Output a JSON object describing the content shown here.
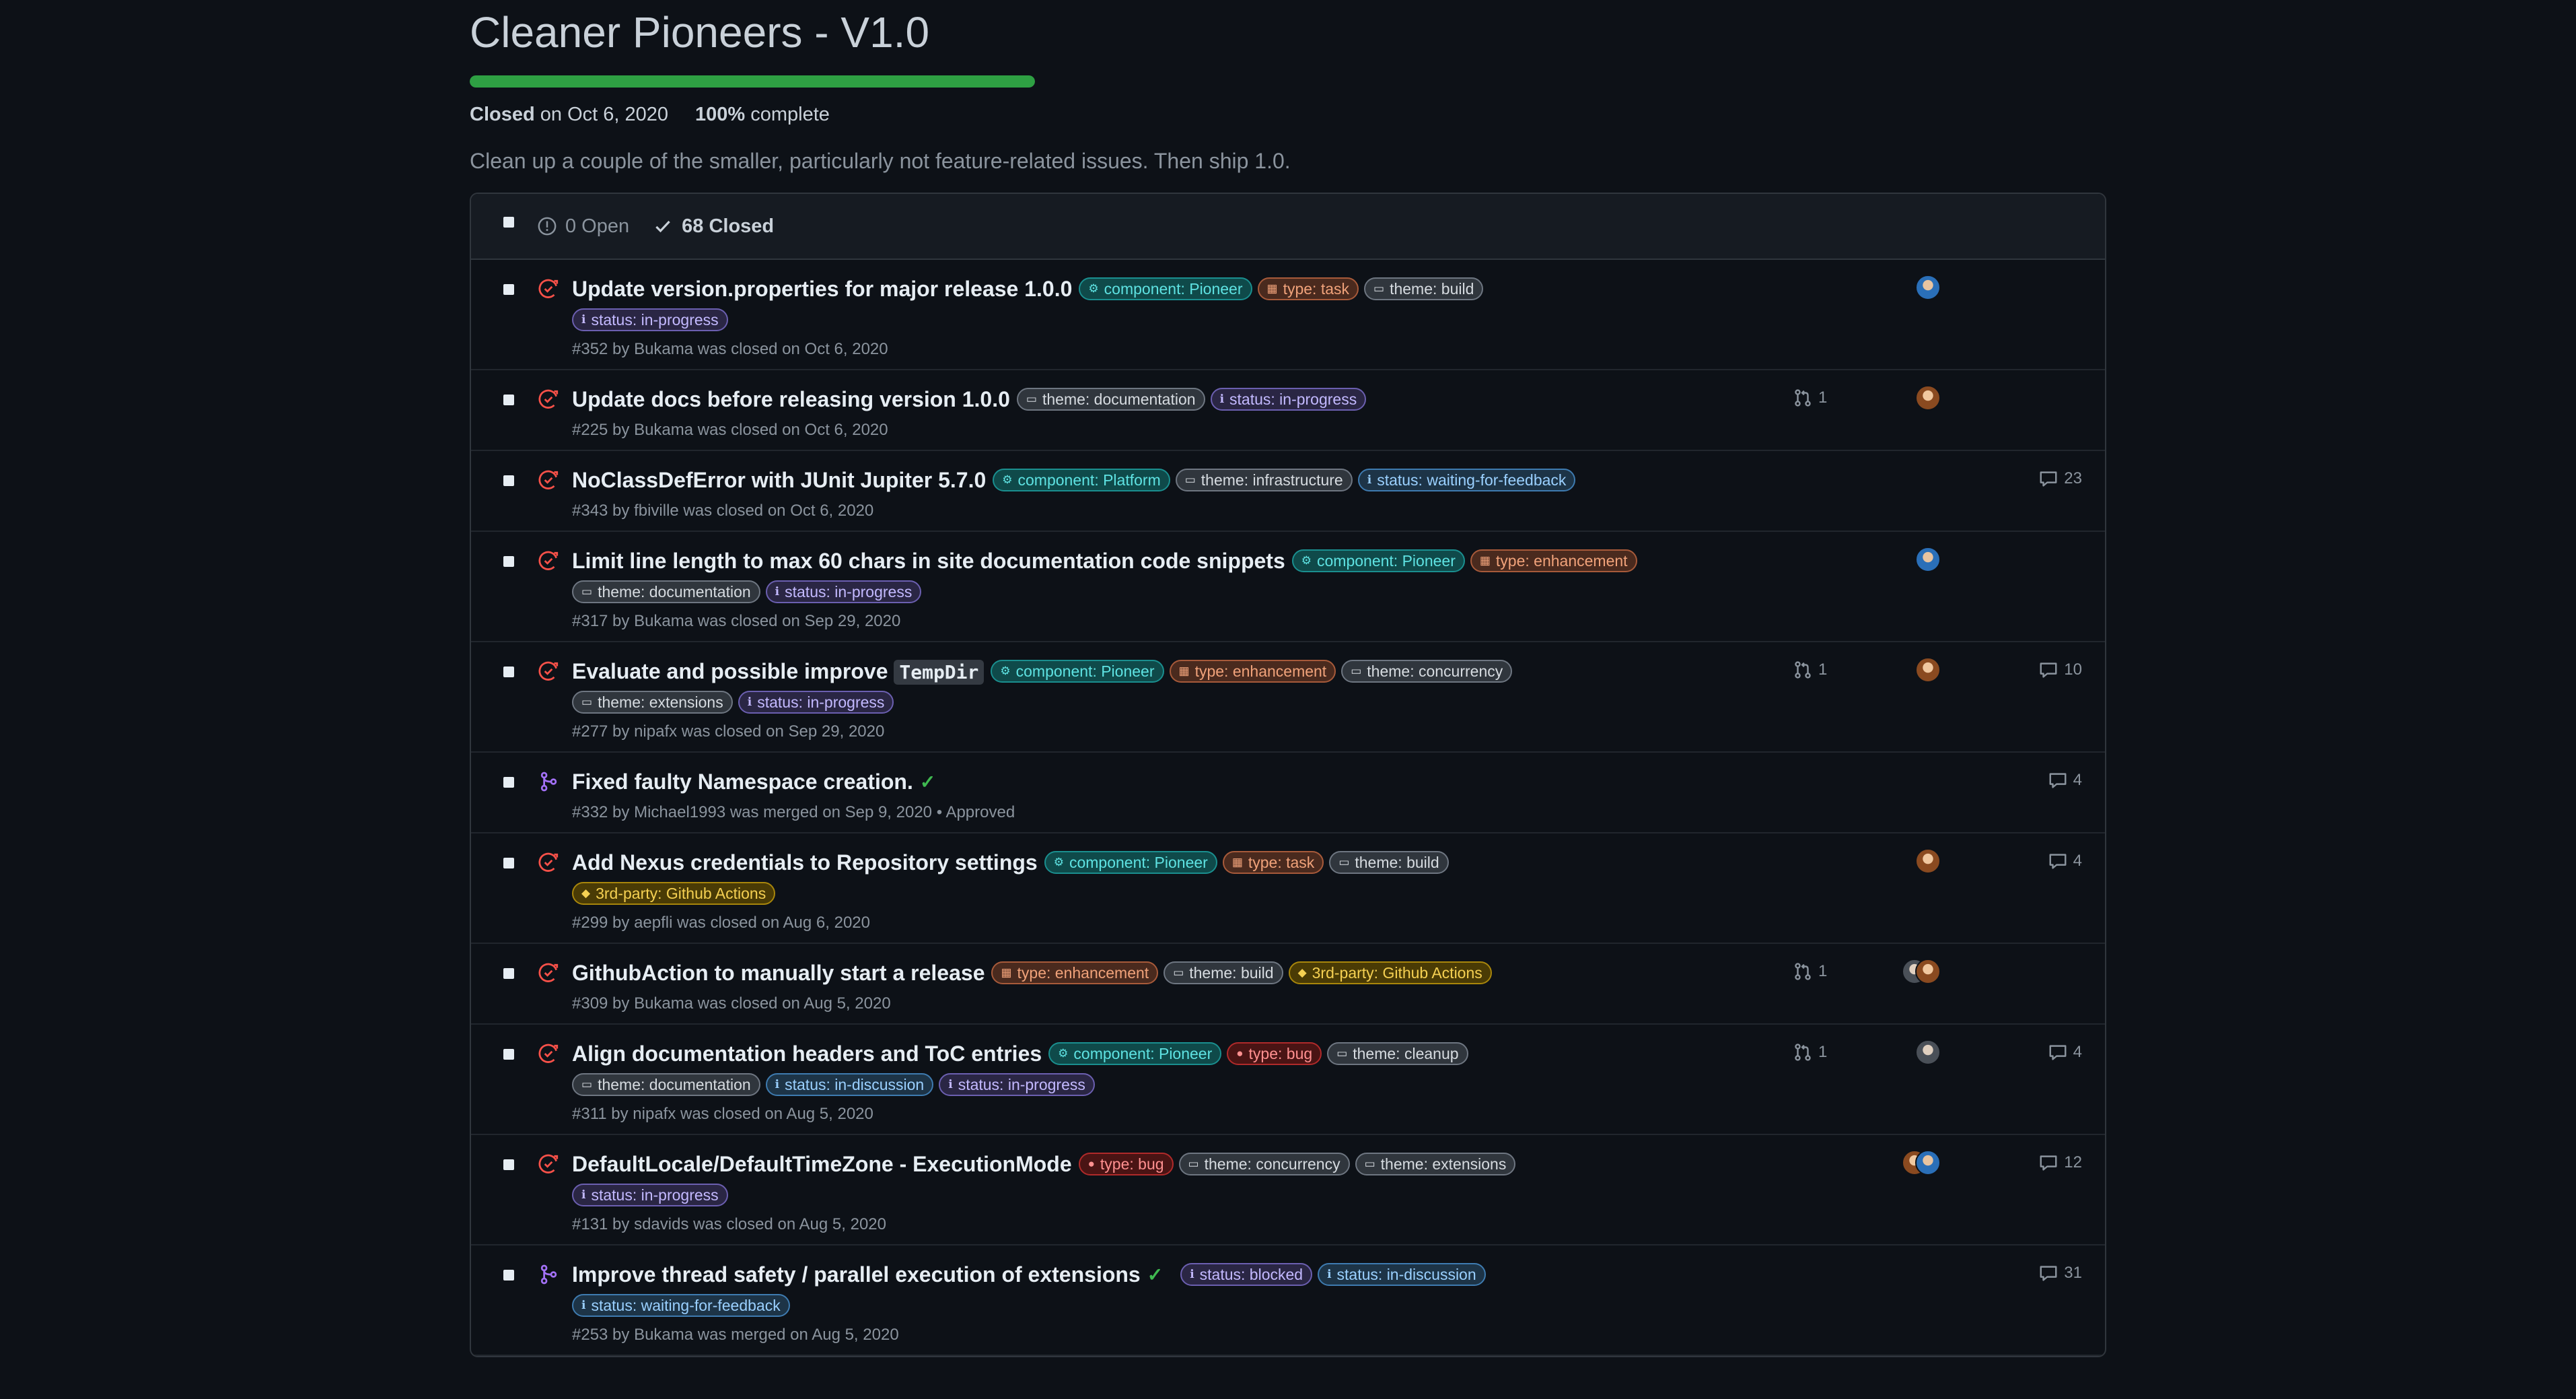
{
  "milestone": {
    "title": "Cleaner Pioneers - V1.0",
    "progress_fraction": 1.0,
    "status_label": "Closed",
    "closed_on": "on Oct 6, 2020",
    "percent_label": "100%",
    "complete_label": "complete",
    "description": "Clean up a couple of the smaller, particularly not feature-related issues. Then ship 1.0."
  },
  "list_header": {
    "open_label": "0 Open",
    "closed_label": "68 Closed"
  },
  "colors": {
    "closed_issue": "#f85149",
    "merged_pr": "#a371f7",
    "progress": "#2ea043",
    "approved_check": "#3fb950"
  },
  "rows": [
    {
      "state": "closed",
      "title": "Update version.properties for major release 1.0.0",
      "labels_line1": [
        {
          "text": "component: Pioneer",
          "kind": "comp",
          "icon": "⚙"
        },
        {
          "text": "type: task",
          "kind": "type",
          "icon": "▦"
        },
        {
          "text": "theme: build",
          "kind": "theme",
          "icon": "▭"
        }
      ],
      "labels_line2": [
        {
          "text": "status: in-progress",
          "kind": "status",
          "icon": "ℹ"
        }
      ],
      "meta": "#352 by Bukama was closed on Oct 6, 2020",
      "prs": "",
      "avatars": [
        "blue"
      ],
      "comments": ""
    },
    {
      "state": "closed",
      "title": "Update docs before releasing version 1.0.0",
      "labels_line1": [
        {
          "text": "theme: documentation",
          "kind": "theme",
          "icon": "▭"
        },
        {
          "text": "status: in-progress",
          "kind": "status",
          "icon": "ℹ"
        }
      ],
      "labels_line2": [],
      "meta": "#225 by Bukama was closed on Oct 6, 2020",
      "prs": "1",
      "avatars": [
        "brown"
      ],
      "comments": ""
    },
    {
      "state": "closed",
      "title": "NoClassDefError with JUnit Jupiter 5.7.0",
      "labels_line1": [
        {
          "text": "component: Platform",
          "kind": "comp",
          "icon": "⚙"
        },
        {
          "text": "theme: infrastructure",
          "kind": "theme",
          "icon": "▭"
        },
        {
          "text": "status: waiting-for-feedback",
          "kind": "statusb",
          "icon": "ℹ"
        }
      ],
      "labels_line2": [],
      "meta": "#343 by fbiville was closed on Oct 6, 2020",
      "prs": "",
      "avatars": [],
      "comments": "23"
    },
    {
      "state": "closed",
      "title": "Limit line length to max 60 chars in site documentation code snippets",
      "labels_line1": [
        {
          "text": "component: Pioneer",
          "kind": "comp",
          "icon": "⚙"
        },
        {
          "text": "type: enhancement",
          "kind": "type",
          "icon": "▦"
        }
      ],
      "labels_line2": [
        {
          "text": "theme: documentation",
          "kind": "theme",
          "icon": "▭"
        },
        {
          "text": "status: in-progress",
          "kind": "status",
          "icon": "ℹ"
        }
      ],
      "meta": "#317 by Bukama was closed on Sep 29, 2020",
      "prs": "",
      "avatars": [
        "blue"
      ],
      "comments": ""
    },
    {
      "state": "closed",
      "title": "Evaluate and possible improve",
      "title_code": "TempDir",
      "labels_line1": [
        {
          "text": "component: Pioneer",
          "kind": "comp",
          "icon": "⚙"
        },
        {
          "text": "type: enhancement",
          "kind": "type",
          "icon": "▦"
        },
        {
          "text": "theme: concurrency",
          "kind": "theme",
          "icon": "▭"
        }
      ],
      "labels_line2": [
        {
          "text": "theme: extensions",
          "kind": "theme",
          "icon": "▭"
        },
        {
          "text": "status: in-progress",
          "kind": "status",
          "icon": "ℹ"
        }
      ],
      "meta": "#277 by nipafx was closed on Sep 29, 2020",
      "prs": "1",
      "avatars": [
        "brown"
      ],
      "comments": "10"
    },
    {
      "state": "merged",
      "title": "Fixed faulty Namespace creation.",
      "approved": true,
      "labels_line1": [],
      "labels_line2": [],
      "meta": "#332 by Michael1993 was merged on Sep 9, 2020 • Approved",
      "prs": "",
      "avatars": [],
      "comments": "4"
    },
    {
      "state": "closed",
      "title": "Add Nexus credentials to Repository settings",
      "labels_line1": [
        {
          "text": "component: Pioneer",
          "kind": "comp",
          "icon": "⚙"
        },
        {
          "text": "type: task",
          "kind": "type",
          "icon": "▦"
        },
        {
          "text": "theme: build",
          "kind": "theme",
          "icon": "▭"
        }
      ],
      "labels_line2": [
        {
          "text": "3rd-party: Github Actions",
          "kind": "3p",
          "icon": "◆"
        }
      ],
      "meta": "#299 by aepfli was closed on Aug 6, 2020",
      "prs": "",
      "avatars": [
        "brown"
      ],
      "comments": "4"
    },
    {
      "state": "closed",
      "title": "GithubAction to manually start a release",
      "labels_line1": [
        {
          "text": "type: enhancement",
          "kind": "type",
          "icon": "▦"
        },
        {
          "text": "theme: build",
          "kind": "theme",
          "icon": "▭"
        },
        {
          "text": "3rd-party: Github Actions",
          "kind": "3p",
          "icon": "◆"
        }
      ],
      "labels_line2": [],
      "meta": "#309 by Bukama was closed on Aug 5, 2020",
      "prs": "1",
      "avatars": [
        "gray",
        "brown"
      ],
      "comments": ""
    },
    {
      "state": "closed",
      "title": "Align documentation headers and ToC entries",
      "labels_line1": [
        {
          "text": "component: Pioneer",
          "kind": "comp",
          "icon": "⚙"
        },
        {
          "text": "type: bug",
          "kind": "bug",
          "icon": "●"
        },
        {
          "text": "theme: cleanup",
          "kind": "theme",
          "icon": "▭"
        }
      ],
      "labels_line2": [
        {
          "text": "theme: documentation",
          "kind": "theme",
          "icon": "▭"
        },
        {
          "text": "status: in-discussion",
          "kind": "statusb",
          "icon": "ℹ"
        },
        {
          "text": "status: in-progress",
          "kind": "status",
          "icon": "ℹ"
        }
      ],
      "meta": "#311 by nipafx was closed on Aug 5, 2020",
      "prs": "1",
      "avatars": [
        "gray"
      ],
      "comments": "4"
    },
    {
      "state": "closed",
      "title": "DefaultLocale/DefaultTimeZone - ExecutionMode",
      "labels_line1": [
        {
          "text": "type: bug",
          "kind": "bug",
          "icon": "●"
        },
        {
          "text": "theme: concurrency",
          "kind": "theme",
          "icon": "▭"
        },
        {
          "text": "theme: extensions",
          "kind": "theme",
          "icon": "▭"
        }
      ],
      "labels_line2": [
        {
          "text": "status: in-progress",
          "kind": "status",
          "icon": "ℹ"
        }
      ],
      "meta": "#131 by sdavids was closed on Aug 5, 2020",
      "prs": "",
      "avatars": [
        "brown",
        "blue"
      ],
      "comments": "12"
    },
    {
      "state": "merged",
      "title": "Improve thread safety / parallel execution of extensions",
      "approved": true,
      "labels_line1": [
        {
          "text": "status: blocked",
          "kind": "status",
          "icon": "ℹ"
        },
        {
          "text": "status: in-discussion",
          "kind": "statusb",
          "icon": "ℹ"
        }
      ],
      "labels_line2": [
        {
          "text": "status: waiting-for-feedback",
          "kind": "statusb",
          "icon": "ℹ"
        }
      ],
      "meta": "#253 by Bukama was merged on Aug 5, 2020",
      "prs": "",
      "avatars": [],
      "comments": "31"
    }
  ]
}
